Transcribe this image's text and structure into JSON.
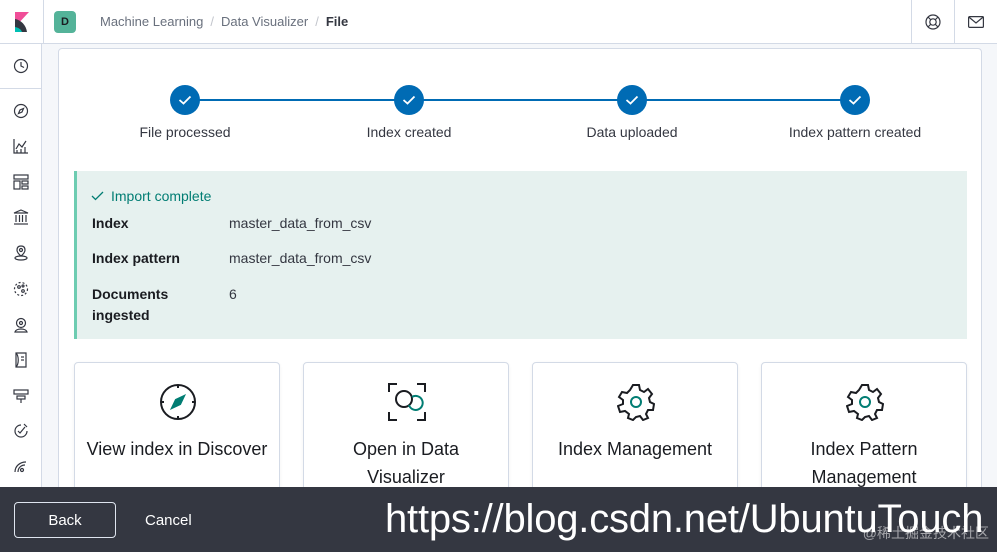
{
  "colors": {
    "accent": "#006bb4",
    "success": "#017d73",
    "callout_bg": "#e6f1ef",
    "callout_border": "#6dccb1",
    "space_avatar_bg": "#54b399",
    "icon_teal": "#017d73"
  },
  "header": {
    "logo_icon": "kibana-logo-icon",
    "space_initial": "D",
    "breadcrumbs": [
      "Machine Learning",
      "Data Visualizer",
      "File"
    ],
    "help_icon": "help-icon",
    "mail_icon": "mail-icon"
  },
  "sidenav": {
    "items": [
      {
        "icon": "recent-clock-icon"
      },
      {
        "icon": "discover-compass-icon"
      },
      {
        "icon": "visualize-icon"
      },
      {
        "icon": "dashboard-icon"
      },
      {
        "icon": "canvas-icon"
      },
      {
        "icon": "maps-icon"
      },
      {
        "icon": "machine-learning-icon"
      },
      {
        "icon": "infrastructure-icon"
      },
      {
        "icon": "logs-icon"
      },
      {
        "icon": "apm-icon"
      },
      {
        "icon": "uptime-icon"
      },
      {
        "icon": "siem-icon"
      }
    ]
  },
  "steps": [
    {
      "label": "File processed",
      "done": true
    },
    {
      "label": "Index created",
      "done": true
    },
    {
      "label": "Data uploaded",
      "done": true
    },
    {
      "label": "Index pattern created",
      "done": true
    }
  ],
  "import": {
    "title": "Import complete",
    "rows": [
      {
        "label": "Index",
        "value": "master_data_from_csv"
      },
      {
        "label": "Index pattern",
        "value": "master_data_from_csv"
      },
      {
        "label": "Documents ingested",
        "value": "6"
      }
    ]
  },
  "cards": [
    {
      "title": "View index in Discover",
      "icon": "compass-icon"
    },
    {
      "title": "Open in Data Visualizer",
      "icon": "data-visualizer-icon"
    },
    {
      "title": "Index Management",
      "icon": "gear-icon"
    },
    {
      "title": "Index Pattern Management",
      "icon": "gear-icon"
    }
  ],
  "bottombar": {
    "back_label": "Back",
    "cancel_label": "Cancel",
    "watermark": "https://blog.csdn.net/UbuntuTouch",
    "watermark_small": "@稀土掘金技术社区"
  }
}
